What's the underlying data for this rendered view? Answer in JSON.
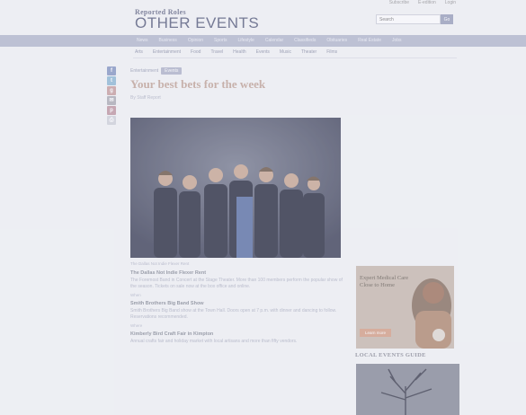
{
  "header": {
    "kicker": "Reported Roles",
    "title": "OTHER EVENTS",
    "top_links": [
      "Subscribe",
      "E-edition",
      "Login"
    ],
    "search_placeholder": "Search",
    "search_button": "Go"
  },
  "nav": [
    "News",
    "Business",
    "Opinion",
    "Sports",
    "Lifestyle",
    "Calendar",
    "Classifieds",
    "Obituaries",
    "Real Estate",
    "Jobs"
  ],
  "subnav": [
    "Arts",
    "Entertainment",
    "Food",
    "Travel",
    "Health",
    "Events",
    "Music",
    "Theater",
    "Films"
  ],
  "article": {
    "section_label": "Entertainment",
    "section_tag": "Events",
    "headline": "Your best bets for the week",
    "byline": "By Staff Report",
    "photo_caption": "The Dallas Not Indie Flexer Rent",
    "subheads": [
      "The Dallas Not Indie Flexer Rent",
      "Smith Brothers Big Band Show",
      "Kimberly Bird Craft Fair in Kimpton"
    ],
    "paragraphs": [
      "The Foremost Band in Concert at the Stage Theater. More than 100 members perform the popular show of the season. Tickets on sale now at the box office and online.",
      "Smith Brothers Big Band show at the Town Hall. Doors open at 7 p.m. with dinner and dancing to follow. Reservations recommended.",
      "Annual crafts fair and holiday market with local artisans and more than fifty vendors."
    ],
    "labels": [
      "When",
      "Where"
    ]
  },
  "sidebar": {
    "ad_text": "Expert Medical Care Close to Home",
    "ad_button": "Learn more",
    "section_title": "LOCAL EVENTS GUIDE"
  },
  "colors": {
    "headline": "#c3a79a",
    "nav_bg": "#b7bccf",
    "brand": "#5a607e"
  }
}
